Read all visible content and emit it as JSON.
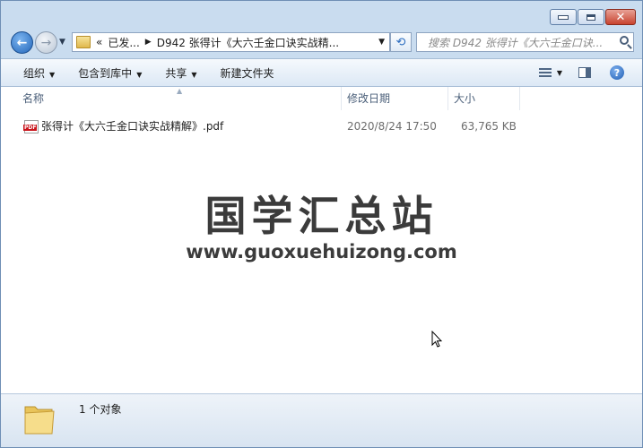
{
  "window": {
    "caption_buttons": [
      "minimize",
      "maximize",
      "close"
    ]
  },
  "nav": {
    "address_segments": [
      "«",
      "已发...",
      "D942 张得计《大六壬金口诀实战精..."
    ],
    "search_placeholder": "搜索 D942 张得计《大六壬金口诀..."
  },
  "toolbar": {
    "organize": "组织",
    "include_in_library": "包含到库中",
    "share": "共享",
    "new_folder": "新建文件夹"
  },
  "columns": {
    "name": "名称",
    "modified": "修改日期",
    "size": "大小"
  },
  "files": [
    {
      "icon": "pdf-icon",
      "name": "张得计《大六壬金口诀实战精解》.pdf",
      "modified": "2020/8/24 17:50",
      "size": "63,765 KB"
    }
  ],
  "watermark": {
    "title": "国学汇总站",
    "url": "www.guoxuehuizong.com"
  },
  "details": {
    "count": "1 个对象"
  },
  "colors": {
    "frame": "#c9dcef",
    "close_button": "#c8432f",
    "pdf_badge": "#c9131a"
  }
}
